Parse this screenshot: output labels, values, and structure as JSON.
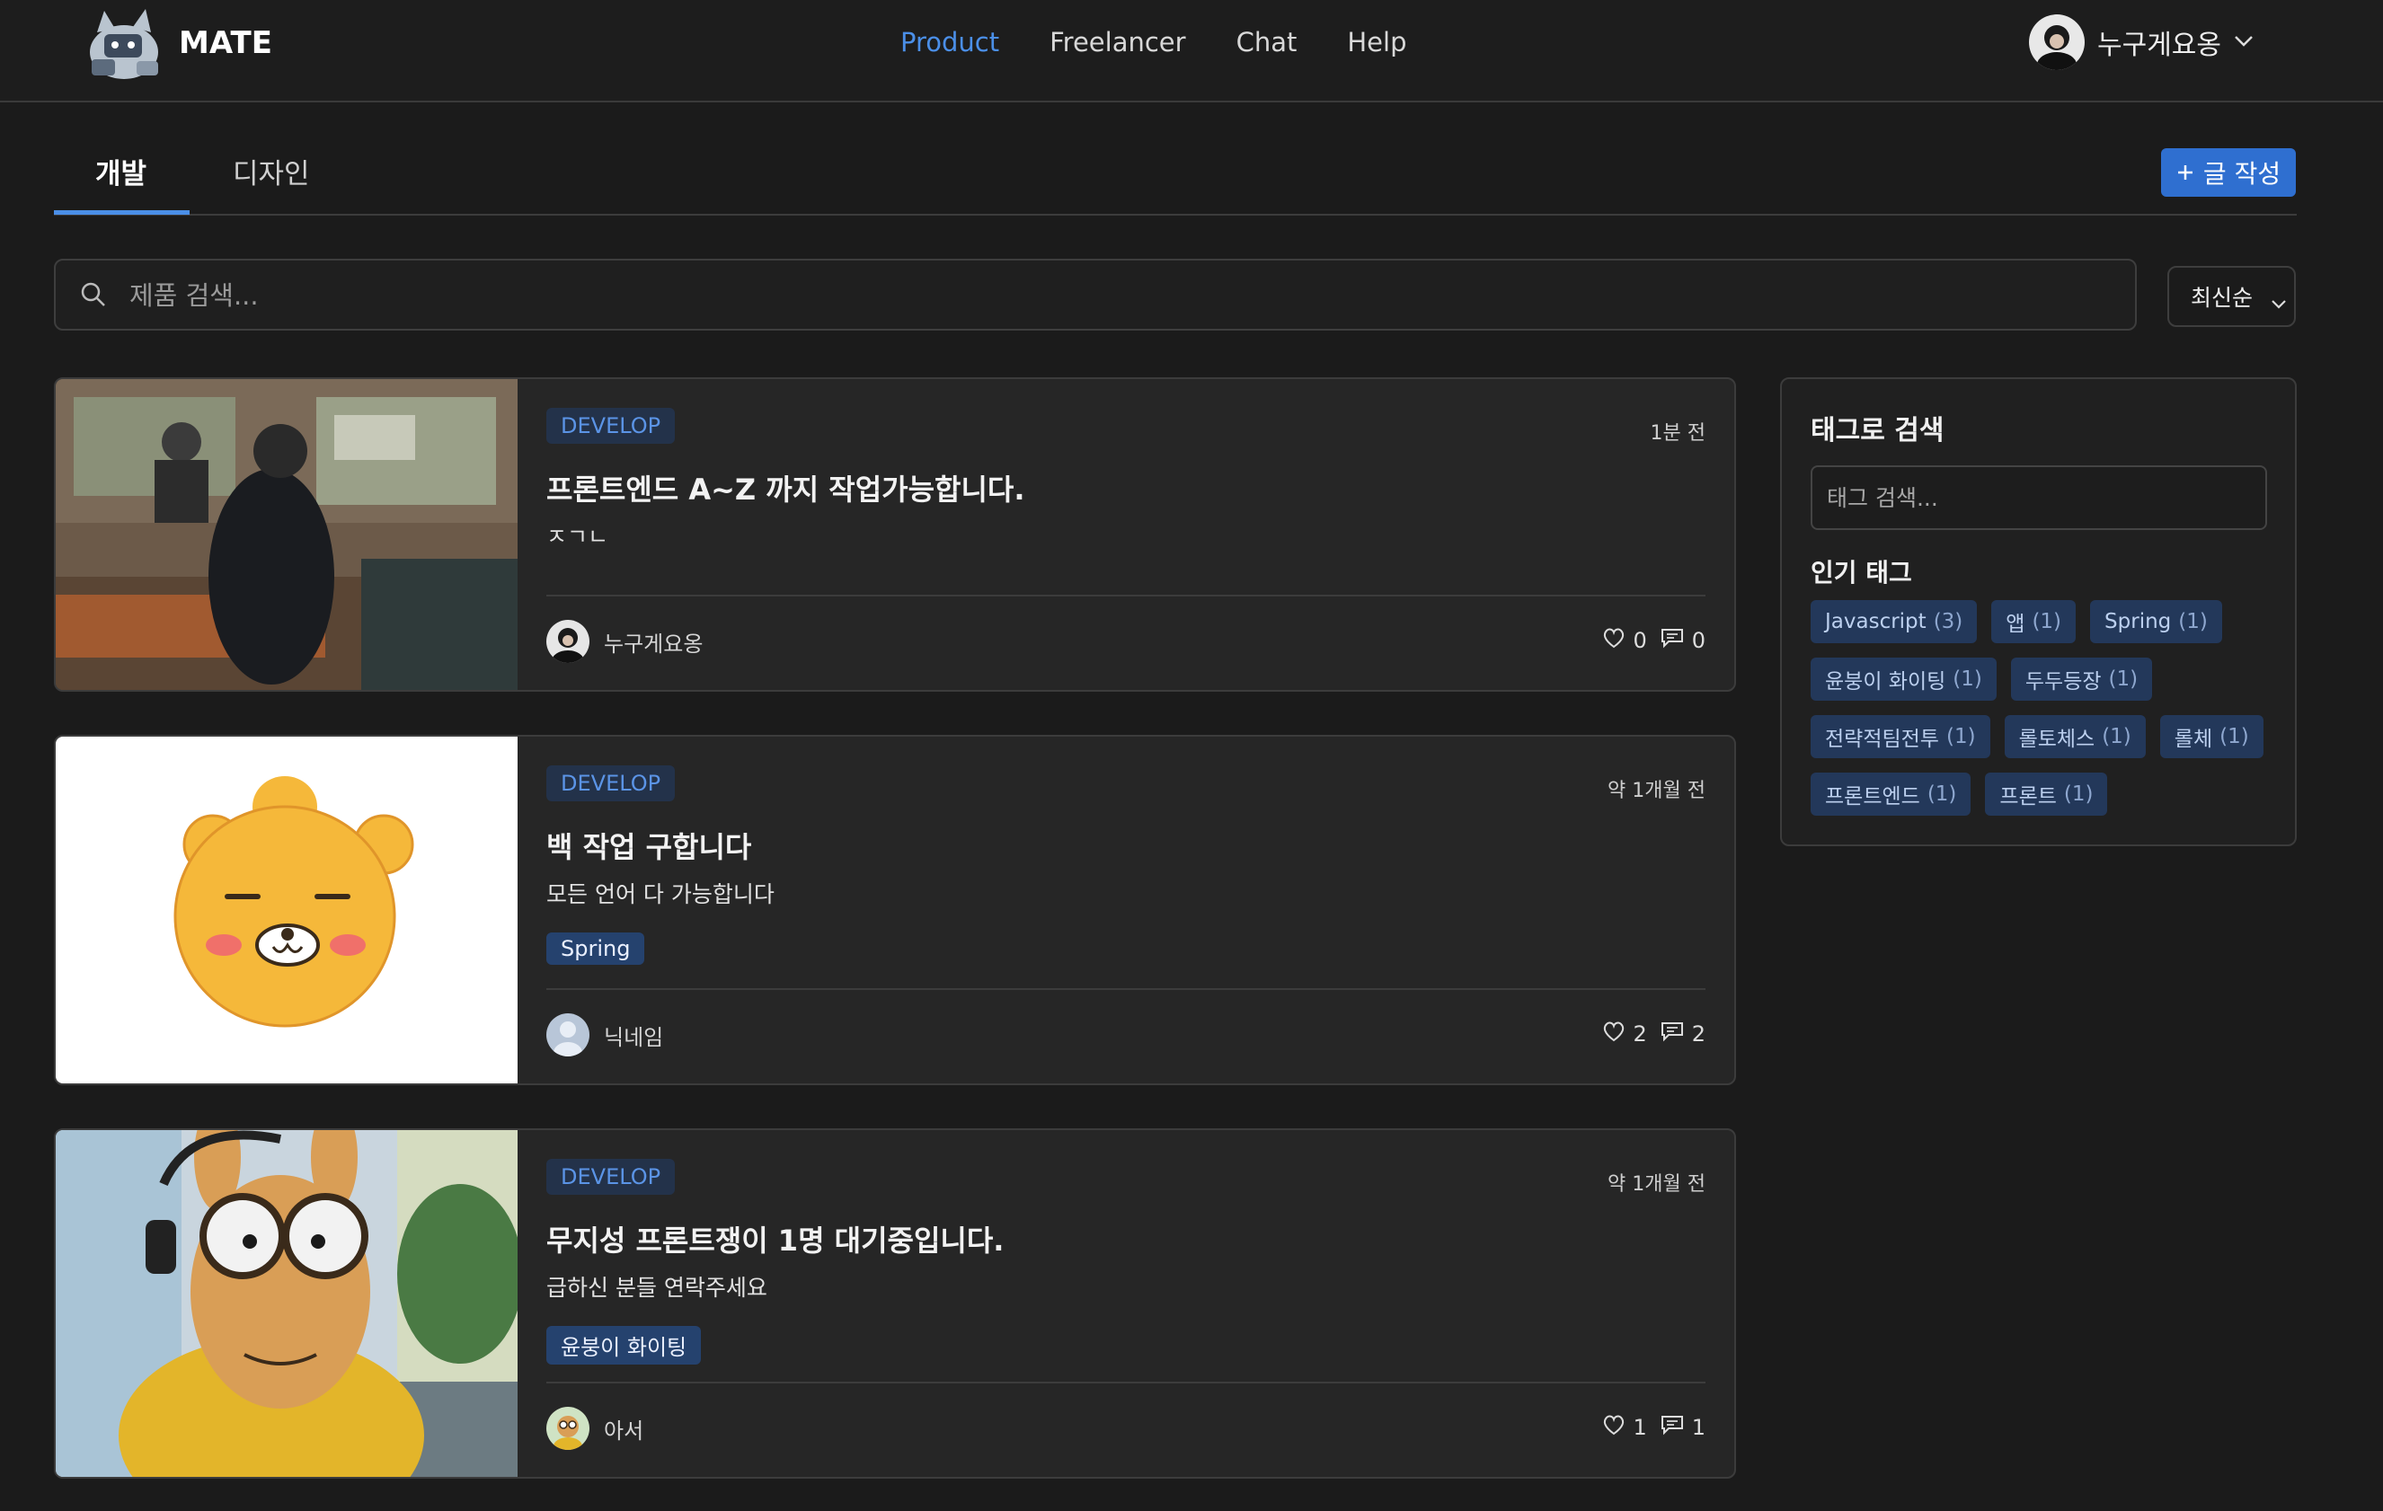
{
  "nav": {
    "brand": "MATE",
    "menu": [
      "Product",
      "Freelancer",
      "Chat",
      "Help"
    ],
    "active_menu": "Product",
    "user_name": "누구게요옹"
  },
  "tabs": [
    {
      "label": "개발",
      "active": true
    },
    {
      "label": "디자인",
      "active": false
    }
  ],
  "write_button": {
    "icon": "plus-icon",
    "label": "글 작성"
  },
  "search": {
    "placeholder": "제품 검색...",
    "value": ""
  },
  "sort": {
    "selected": "최신순"
  },
  "posts": [
    {
      "category": "DEVELOP",
      "time": "1분 전",
      "title": "프론트엔드 A~Z 까지 작업가능합니다.",
      "description": "ㅈㄱㄴ",
      "tags": [],
      "author": "누구게요옹",
      "likes": "0",
      "comments": "0"
    },
    {
      "category": "DEVELOP",
      "time": "약 1개월 전",
      "title": "백 작업 구합니다",
      "description": "모든 언어 다 가능합니다",
      "tags": [
        "Spring"
      ],
      "author": "닉네임",
      "likes": "2",
      "comments": "2"
    },
    {
      "category": "DEVELOP",
      "time": "약 1개월 전",
      "title": "무지성 프론트쟁이 1명 대기중입니다.",
      "description": "급하신 분들 연락주세요",
      "tags": [
        "윤붕이 화이팅"
      ],
      "author": "아서",
      "likes": "1",
      "comments": "1"
    }
  ],
  "sidebar": {
    "title": "태그로 검색",
    "tag_search_placeholder": "태그 검색...",
    "popular_title": "인기 태그",
    "popular_tags": [
      {
        "name": "Javascript",
        "count": "(3)"
      },
      {
        "name": "앱",
        "count": "(1)"
      },
      {
        "name": "Spring",
        "count": "(1)"
      },
      {
        "name": "윤붕이 화이팅",
        "count": "(1)"
      },
      {
        "name": "두두등장",
        "count": "(1)"
      },
      {
        "name": "전략적팀전투",
        "count": "(1)"
      },
      {
        "name": "롤토체스",
        "count": "(1)"
      },
      {
        "name": "롤체",
        "count": "(1)"
      },
      {
        "name": "프론트엔드",
        "count": "(1)"
      },
      {
        "name": "프론트",
        "count": "(1)"
      }
    ]
  },
  "colors": {
    "accent": "#4b8fe8",
    "button": "#2f6fd0",
    "background": "#1b1b1b",
    "card": "#262626"
  }
}
